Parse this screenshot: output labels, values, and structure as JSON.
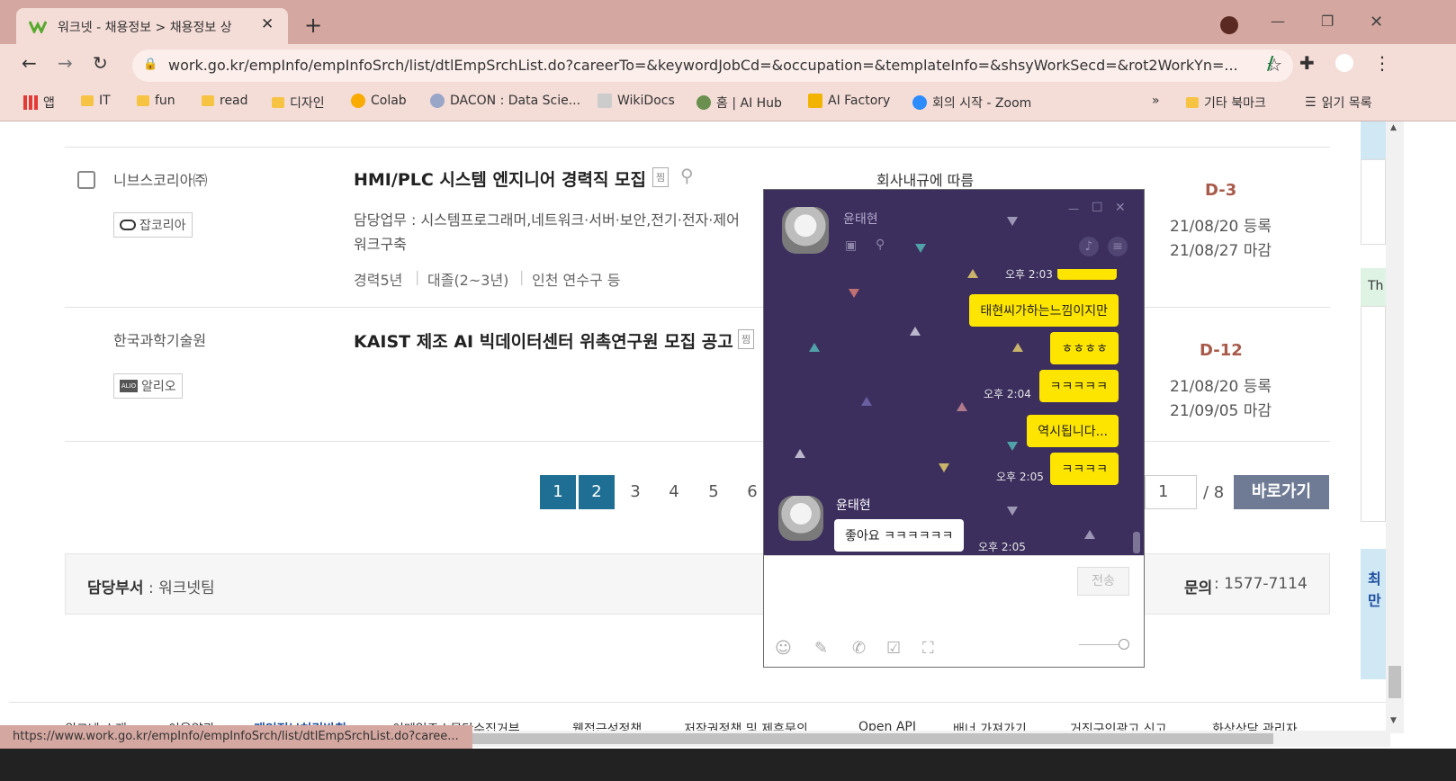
{
  "browser": {
    "tab_title": "워크넷 - 채용정보 > 채용정보 상",
    "url": "work.go.kr/empInfo/empInfoSrch/list/dtlEmpSrchList.do?careerTo=&keywordJobCd=&occupation=&templateInfo=&shsyWorkSecd=&rot2WorkYn=...",
    "bookmarks": [
      "앱",
      "IT",
      "fun",
      "read",
      "디자인",
      "Colab",
      "DACON : Data Scie...",
      "WikiDocs",
      "홈 | AI Hub",
      "AI Factory",
      "회의 시작 - Zoom"
    ],
    "other_bookmarks": "기타 북마크",
    "reading_list": "읽기 목록",
    "more": "»",
    "status_url": "https://www.work.go.kr/empInfo/empInfoSrch/list/dtlEmpSrchList.do?caree..."
  },
  "jobs": [
    {
      "company": "니브스코리아㈜",
      "source": "잡코리아",
      "title": "HMI/PLC 시스템 엔지니어 경력직 모집",
      "badge": "찜",
      "duty": "담당업무 : 시스템프로그래머,네트워크·서버·보안,전기·전자·제어",
      "duty2": "워크구축",
      "career": "경력5년",
      "education": "대졸(2~3년)",
      "location": "인천 연수구 등",
      "salary": "회사내규에 따름",
      "dday": "D-3",
      "registered": "21/08/20 등록",
      "deadline": "21/08/27 마감"
    },
    {
      "company": "한국과학기술원",
      "source": "알리오",
      "title": "KAIST 제조 AI 빅데이터센터 위촉연구원 모집 공고",
      "badge": "찜",
      "dday": "D-12",
      "registered": "21/08/20 등록",
      "deadline": "21/09/05 마감"
    }
  ],
  "pagination": {
    "pages": [
      "1",
      "2",
      "3",
      "4",
      "5",
      "6"
    ],
    "goto_value": "1",
    "total": "/ 8",
    "goto_button": "바로가기"
  },
  "footer": {
    "dept_label": "담당부서",
    "dept_value": " : 워크넷팀",
    "contact_label": "문의",
    "contact_value": " : 1577-7114",
    "links": [
      "워크넷 소개",
      "이용약관",
      "개인정보처리방침",
      "이메일주소무단수집거부",
      "웹접근성정책",
      "저작권정책 및 제휴문의",
      "Open API",
      "배너 가져가기",
      "거짓구인광고 신고",
      "화상상담 관리자"
    ]
  },
  "chat": {
    "name": "윤태현",
    "messages": [
      {
        "text": "태현씨가하는느낌이지만",
        "time": ""
      },
      {
        "text": "ㅎㅎㅎㅎ",
        "time": ""
      },
      {
        "text": "ㅋㅋㅋㅋㅋ",
        "time": "오후 2:04"
      },
      {
        "text": "역시됩니다...",
        "time": ""
      },
      {
        "text": "ㅋㅋㅋㅋ",
        "time": "오후 2:05"
      }
    ],
    "top_time": "오후 2:03",
    "reply_sender": "윤태현",
    "reply_text": "좋아요 ㅋㅋㅋㅋㅋㅋ",
    "reply_time": "오후 2:05",
    "send_label": "전송"
  },
  "edge": {
    "th": "Th",
    "side_a": "최",
    "side_b": "만"
  },
  "colors": {
    "accent": "#1e6f93",
    "chat_bg": "#3c2f5e",
    "bubble": "#fee500",
    "goto_btn": "#6f7b94",
    "chrome": "#d4a7a0"
  }
}
